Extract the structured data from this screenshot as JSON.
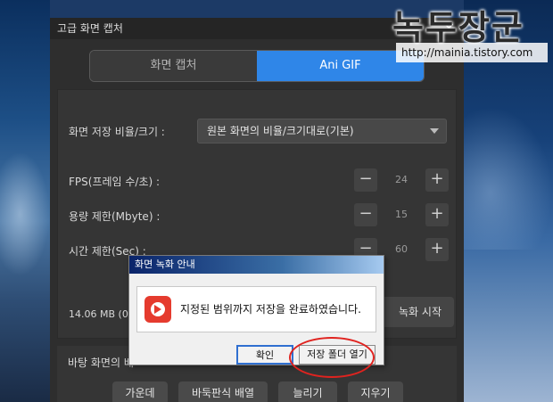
{
  "watermark": {
    "title": "녹두장군",
    "url": "http://mainia.tistory.com"
  },
  "window": {
    "title": "고급 화면 캡처",
    "close_label": "✕"
  },
  "tabs": [
    {
      "label": "화면 캡처",
      "active": false
    },
    {
      "label": "Ani GIF",
      "active": true
    }
  ],
  "settings": {
    "ratio_label": "화면 저장 비율/크기 :",
    "ratio_value": "원본 화면의 비율/크기대로(기본)",
    "fps_label": "FPS(프레임 수/초) :",
    "fps_value": "24",
    "size_limit_label": "용량 제한(Mbyte) :",
    "size_limit_value": "15",
    "time_limit_label": "시간 제한(Sec) :",
    "time_limit_value": "60",
    "minus": "−",
    "plus": "+"
  },
  "status": {
    "size_text": "14.06 MB (00",
    "record_button": "녹화 시작"
  },
  "background": {
    "label": "바탕 화면의 배",
    "buttons": [
      "가운데",
      "바둑판식 배열",
      "늘리기",
      "지우기"
    ]
  },
  "dialog": {
    "title": "화면 녹화 안내",
    "message": "지정된 범위까지 저장을 완료하였습니다.",
    "ok_button": "확인",
    "open_folder_button": "저장 폴더 열기"
  },
  "colors": {
    "accent": "#2f86e8",
    "dialog_title": "#0a246a",
    "highlight_circle": "#e0231f"
  }
}
